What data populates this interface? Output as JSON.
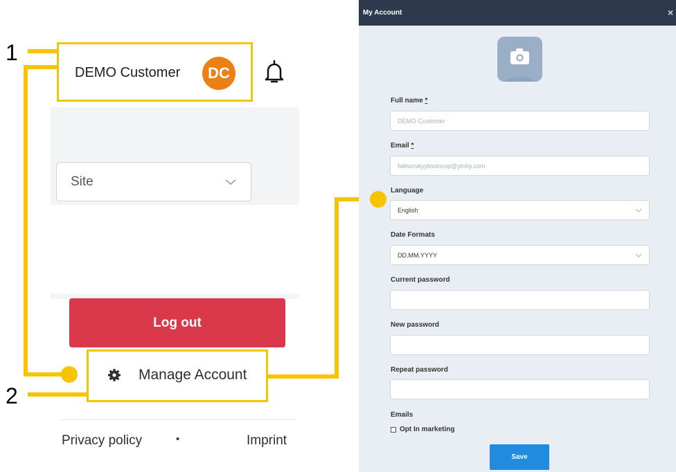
{
  "left_panel": {
    "user_name": "DEMO Customer",
    "avatar_initials": "DC",
    "site_select": "Site",
    "logout_label": "Log out",
    "manage_account_label": "Manage Account",
    "privacy_label": "Privacy policy",
    "separator": "•",
    "imprint_label": "Imprint"
  },
  "annotations": {
    "marker_1": "1",
    "marker_2": "2"
  },
  "modal": {
    "title": "My Account",
    "close": "×",
    "full_name_label": "Full name",
    "required_mark": "*",
    "full_name_placeholder": "DEMO Customer",
    "email_label": "Email",
    "email_placeholder": "faltiwcvkyybsonvop@ytnhy.com",
    "language_label": "Language",
    "language_value": "English",
    "date_formats_label": "Date Formats",
    "date_formats_value": "DD.MM.YYYY",
    "current_password_label": "Current password",
    "new_password_label": "New password",
    "repeat_password_label": "Repeat password",
    "emails_label": "Emails",
    "opt_in_label": "Opt In marketing",
    "save_label": "Save"
  },
  "colors": {
    "highlight": "#f6c400",
    "avatar": "#ec8014",
    "logout": "#d9394a",
    "modal_header": "#2d3a4e",
    "save": "#1f8ce0"
  }
}
